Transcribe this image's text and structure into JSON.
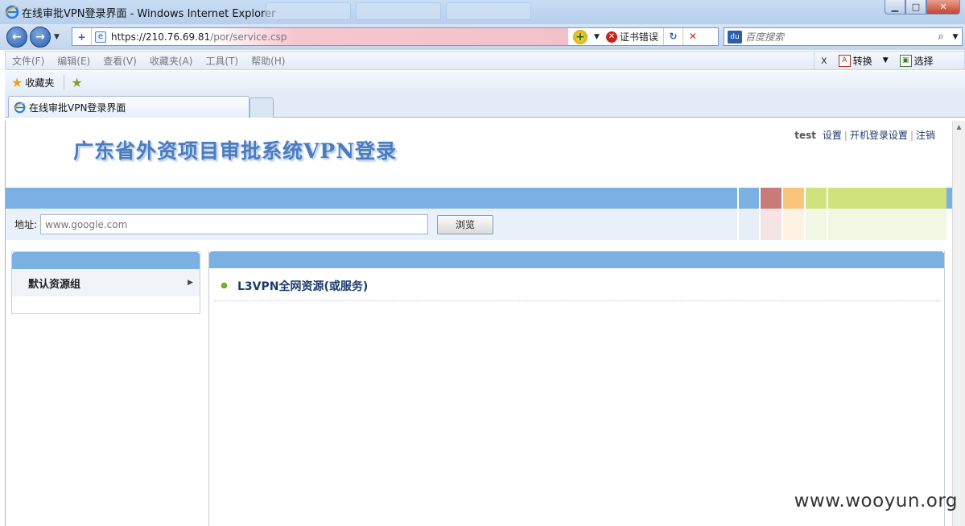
{
  "window": {
    "title": "在线审批VPN登录界面 - Windows Internet Explorer",
    "controls": {
      "minimize": "▁",
      "maximize": "□",
      "close": "✕"
    }
  },
  "nav": {
    "back_icon": "back-arrow-icon",
    "forward_icon": "forward-arrow-icon",
    "url_host": "https://210.76.69.81",
    "url_path": "/por/service.csp",
    "cert_error": "证书错误",
    "search_placeholder": "百度搜索"
  },
  "menu": {
    "items": [
      "文件(F)",
      "编辑(E)",
      "查看(V)",
      "收藏夹(A)",
      "工具(T)",
      "帮助(H)"
    ],
    "close_x": "x",
    "convert": "转换",
    "select": "选择"
  },
  "favorites": {
    "label": "收藏夹"
  },
  "tab": {
    "label": "在线审批VPN登录界面"
  },
  "page": {
    "title": "广东省外资项目审批系统VPN登录",
    "user": "test",
    "links": [
      "设置",
      "开机登录设置",
      "注销"
    ],
    "address_label": "地址:",
    "address_placeholder": "www.google.com",
    "browse_button": "浏览",
    "resource_group": "默认资源组",
    "resource_item": "L3VPN全网资源(或服务)",
    "band_colors": [
      "#7ab0e2",
      "#c97a7a",
      "#f9c37a",
      "#cfe27c",
      "#cfe27c"
    ],
    "band_colors_light": [
      "#e6eef7",
      "#f6e3e4",
      "#fdf1e1",
      "#f2f7e3",
      "#f2f7e3"
    ]
  },
  "watermark": "www.wooyun.org"
}
